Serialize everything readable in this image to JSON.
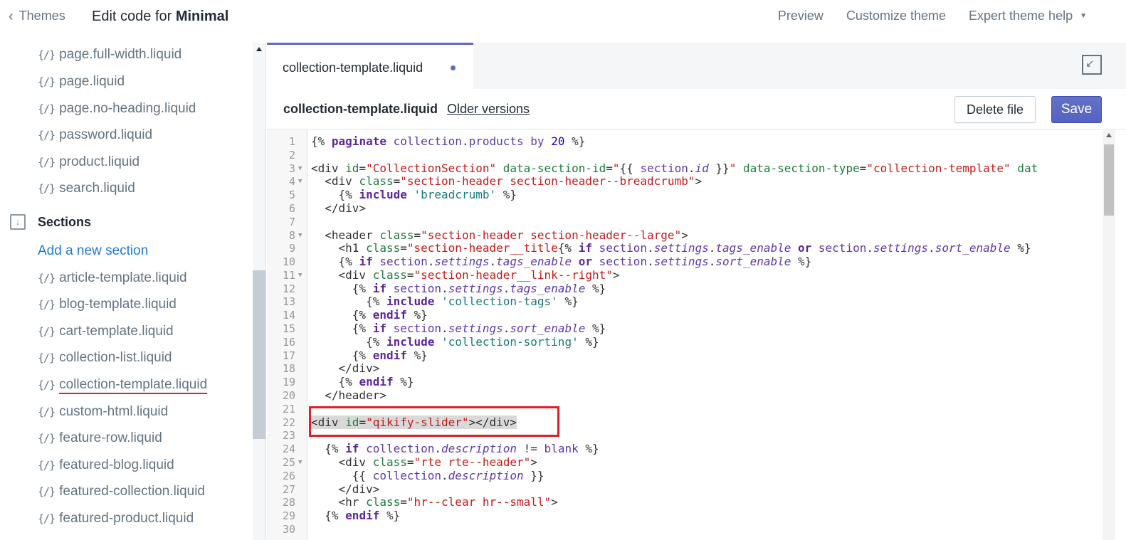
{
  "topbar": {
    "back_label": "Themes",
    "title_prefix": "Edit code for ",
    "theme_name": "Minimal",
    "preview": "Preview",
    "customize": "Customize theme",
    "help": "Expert theme help"
  },
  "sidebar": {
    "templates": [
      "page.full-width.liquid",
      "page.liquid",
      "page.no-heading.liquid",
      "password.liquid",
      "product.liquid",
      "search.liquid"
    ],
    "sections_label": "Sections",
    "add_section": "Add a new section",
    "sections": [
      "article-template.liquid",
      "blog-template.liquid",
      "cart-template.liquid",
      "collection-list.liquid",
      "collection-template.liquid",
      "custom-html.liquid",
      "feature-row.liquid",
      "featured-blog.liquid",
      "featured-collection.liquid",
      "featured-product.liquid"
    ],
    "file_icon": "{/}"
  },
  "editor": {
    "tab_label": "collection-template.liquid",
    "file_name": "collection-template.liquid",
    "older_versions": "Older versions",
    "delete_label": "Delete file",
    "save_label": "Save"
  },
  "colors": {
    "accent": "#5c6ac4",
    "link": "#1f7ad1",
    "annotation": "#e02020"
  }
}
